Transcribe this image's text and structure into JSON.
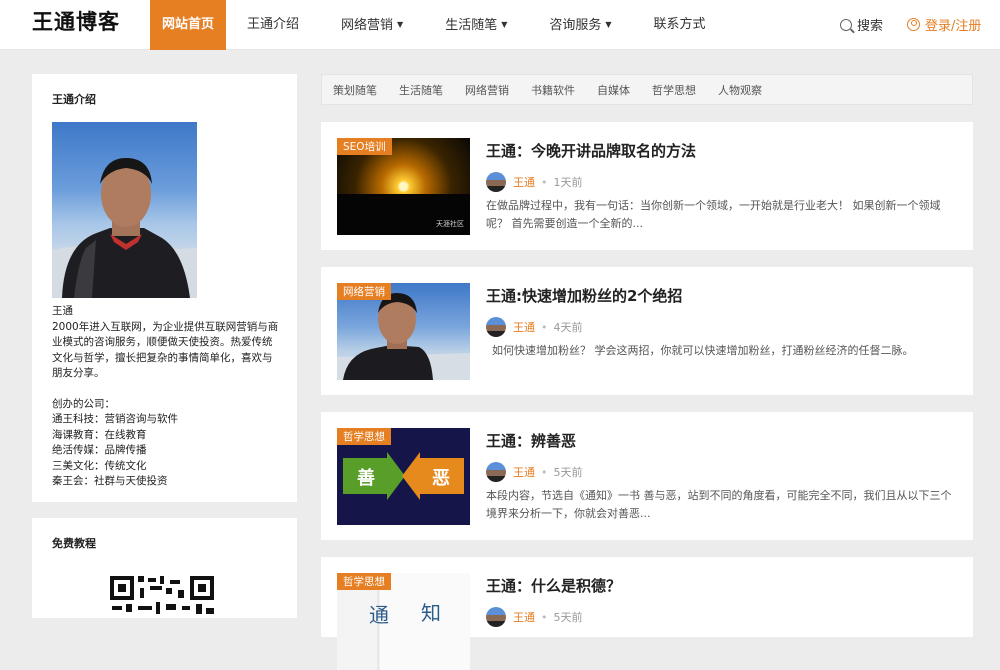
{
  "header": {
    "logo": "王通博客",
    "nav": [
      {
        "label": "网站首页",
        "active": true,
        "dropdown": false
      },
      {
        "label": "王通介绍",
        "active": false,
        "dropdown": false
      },
      {
        "label": "网络营销",
        "active": false,
        "dropdown": true
      },
      {
        "label": "生活随笔",
        "active": false,
        "dropdown": true
      },
      {
        "label": "咨询服务",
        "active": false,
        "dropdown": true
      },
      {
        "label": "联系方式",
        "active": false,
        "dropdown": false
      }
    ],
    "search_label": "搜索",
    "login_label": "登录/注册"
  },
  "sidebar": {
    "intro_title": "王通介绍",
    "name": "王通",
    "bio": "2000年进入互联网，为企业提供互联网营销与商业模式的咨询服务，顺便做天使投资。热爱传统文化与哲学，擅长把复杂的事情简单化，喜欢与朋友分享。",
    "companies_title": "创办的公司：",
    "companies": [
      "通王科技：营销咨询与软件",
      "海课教育：在线教育",
      "绝活传媒：品牌传播",
      "三美文化：传统文化",
      "秦王会：社群与天使投资"
    ],
    "tutorial_title": "免费教程"
  },
  "categories": [
    "策划随笔",
    "生活随笔",
    "网络营销",
    "书籍软件",
    "自媒体",
    "哲学思想",
    "人物观察"
  ],
  "posts": [
    {
      "tag": "SEO培训",
      "title": "王通：今晚开讲品牌取名的方法",
      "author": "王通",
      "time": "1天前",
      "excerpt": "在做品牌过程中，我有一句话：当你创新一个领域，一开始就是行业老大！ 如果创新一个领域呢？ 首先需要创造一个全新的...",
      "watermark": "天涯社区"
    },
    {
      "tag": "网络营销",
      "title": "王通:快速增加粉丝的2个绝招",
      "author": "王通",
      "time": "4天前",
      "excerpt": "如何快速增加粉丝？ 学会这两招，你就可以快速增加粉丝，打通粉丝经济的任督二脉。"
    },
    {
      "tag": "哲学思想",
      "title": "王通：辨善恶",
      "author": "王通",
      "time": "5天前",
      "excerpt": "本段内容，节选自《通知》一书 善与恶，站到不同的角度看，可能完全不同，我们且从以下三个境界来分析一下，你就会对善恶...",
      "glyph_left": "善",
      "glyph_right": "恶"
    },
    {
      "tag": "哲学思想",
      "title": "王通：什么是积德？",
      "author": "王通",
      "time": "5天前",
      "book_left": "通",
      "book_right": "知"
    }
  ],
  "colors": {
    "accent": "#e67e22",
    "page_bg": "#ececec"
  }
}
